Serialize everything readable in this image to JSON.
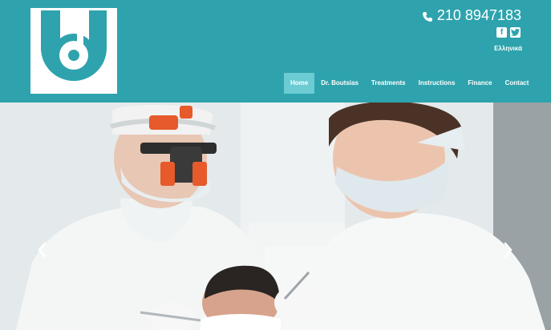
{
  "header": {
    "phone": "210 8947183",
    "language": "Ελληνικά",
    "icons": {
      "phone": "phone-icon",
      "facebook": "facebook-icon",
      "twitter": "twitter-icon"
    },
    "social": {
      "facebook_glyph": "f"
    }
  },
  "nav": {
    "items": [
      {
        "label": "Home",
        "active": true
      },
      {
        "label": "Dr. Boutsias",
        "active": false
      },
      {
        "label": "Treatments",
        "active": false
      },
      {
        "label": "Instructions",
        "active": false
      },
      {
        "label": "Finance",
        "active": false
      },
      {
        "label": "Contact",
        "active": false
      }
    ]
  },
  "carousel": {
    "prev_icon": "chevron-left-icon",
    "next_icon": "chevron-right-icon"
  },
  "colors": {
    "header_bg": "#2ea3ad",
    "nav_active_bg": "#6ccbd3",
    "text_on_header": "#ffffff"
  }
}
